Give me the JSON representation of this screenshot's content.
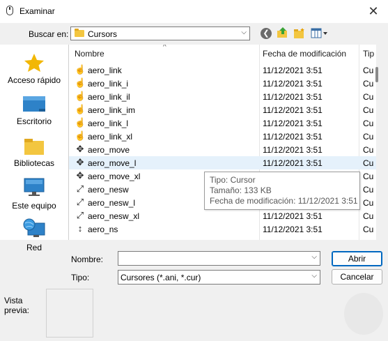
{
  "window": {
    "title": "Examinar",
    "close_glyph": "✕"
  },
  "lookin": {
    "label": "Buscar en:",
    "value": "Cursors",
    "arrow": "⌵"
  },
  "toolbar": {
    "back_glyph": "❮"
  },
  "sidebar": {
    "items": [
      {
        "label": "Acceso rápido",
        "icon": "star-icon"
      },
      {
        "label": "Escritorio",
        "icon": "desktop-icon"
      },
      {
        "label": "Bibliotecas",
        "icon": "libraries-icon"
      },
      {
        "label": "Este equipo",
        "icon": "computer-icon"
      },
      {
        "label": "Red",
        "icon": "network-icon"
      }
    ]
  },
  "columns": {
    "name": "Nombre",
    "date": "Fecha de modificación",
    "type": "Tip",
    "sort_glyph": "^"
  },
  "files": [
    {
      "name": "aero_link",
      "date": "11/12/2021 3:51",
      "type": "Cu",
      "glyph": "☝"
    },
    {
      "name": "aero_link_i",
      "date": "11/12/2021 3:51",
      "type": "Cu",
      "glyph": "☝"
    },
    {
      "name": "aero_link_il",
      "date": "11/12/2021 3:51",
      "type": "Cu",
      "glyph": "☝"
    },
    {
      "name": "aero_link_im",
      "date": "11/12/2021 3:51",
      "type": "Cu",
      "glyph": "☝"
    },
    {
      "name": "aero_link_l",
      "date": "11/12/2021 3:51",
      "type": "Cu",
      "glyph": "☝"
    },
    {
      "name": "aero_link_xl",
      "date": "11/12/2021 3:51",
      "type": "Cu",
      "glyph": "☝"
    },
    {
      "name": "aero_move",
      "date": "11/12/2021 3:51",
      "type": "Cu",
      "glyph": "✥"
    },
    {
      "name": "aero_move_l",
      "date": "11/12/2021 3:51",
      "type": "Cu",
      "glyph": "✥"
    },
    {
      "name": "aero_move_xl",
      "date": "",
      "type": "Cu",
      "glyph": "✥"
    },
    {
      "name": "aero_nesw",
      "date": "",
      "type": "Cu",
      "glyph": "⤢"
    },
    {
      "name": "aero_nesw_l",
      "date": "",
      "type": "Cu",
      "glyph": "⤢"
    },
    {
      "name": "aero_nesw_xl",
      "date": "11/12/2021 3:51",
      "type": "Cu",
      "glyph": "⤢"
    },
    {
      "name": "aero_ns",
      "date": "11/12/2021 3:51",
      "type": "Cu",
      "glyph": "↕"
    }
  ],
  "selected_row": "aero_move_l",
  "tooltip": {
    "type": "Tipo: Cursor",
    "size": "Tamaño: 133 KB",
    "modified": "Fecha de modificación: 11/12/2021 3:51"
  },
  "filename": {
    "label": "Nombre:",
    "value": "",
    "arrow": "⌵"
  },
  "filetype": {
    "label": "Tipo:",
    "value": "Cursores (*.ani, *.cur)",
    "arrow": "⌵"
  },
  "buttons": {
    "open": "Abrir",
    "cancel": "Cancelar"
  },
  "preview": {
    "label": "Vista\nprevia:"
  },
  "colors": {
    "selection": "#e5f1fb",
    "accent": "#0067c0",
    "folder": "#f3c640"
  }
}
